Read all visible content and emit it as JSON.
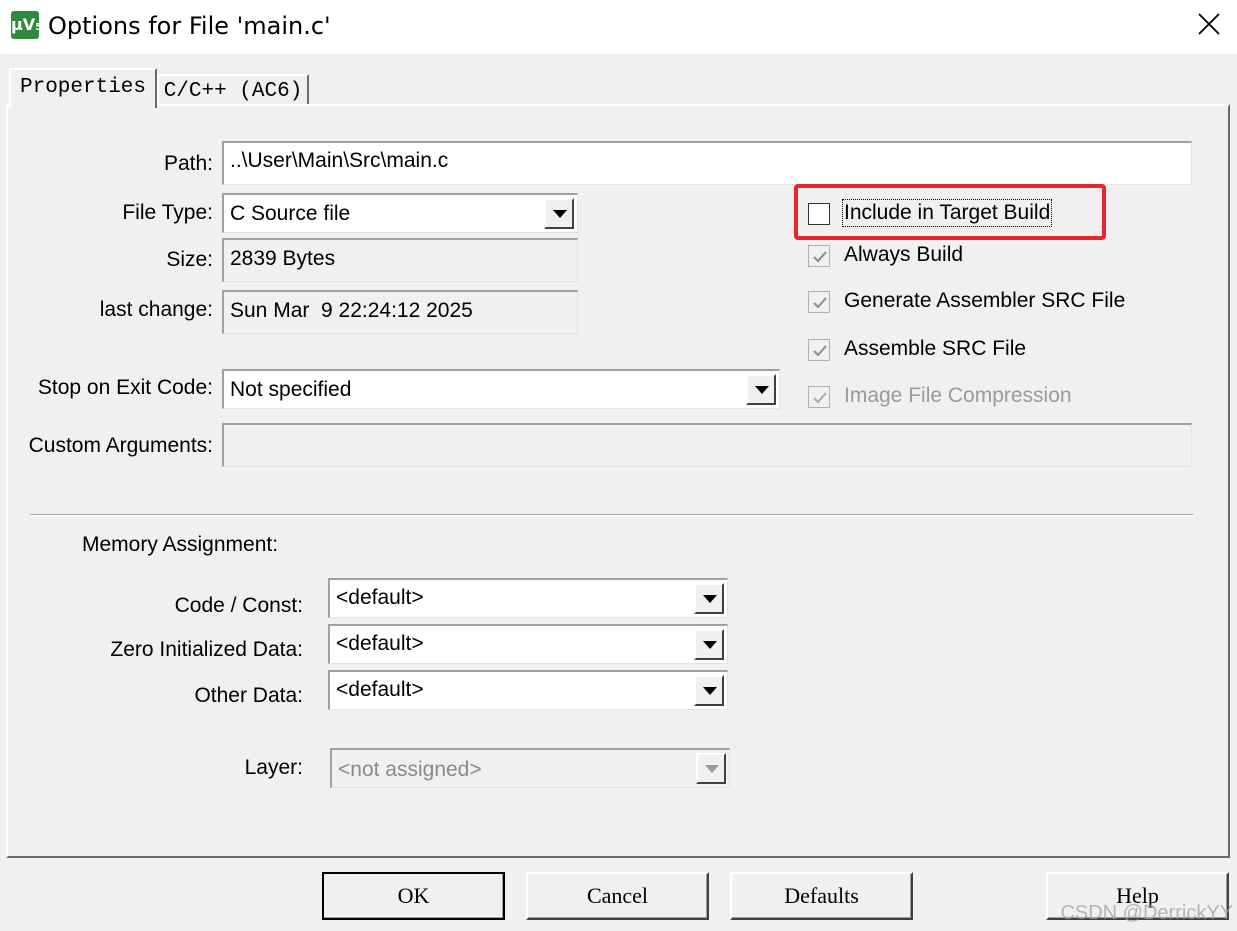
{
  "window": {
    "title": "Options for File 'main.c'",
    "icon_text": "μV",
    "icon_sub": "5"
  },
  "tabs": [
    {
      "label": "Properties",
      "active": true
    },
    {
      "label": "C/C++ (AC6)",
      "active": false
    }
  ],
  "properties": {
    "path_label": "Path:",
    "path_value": "..\\User\\Main\\Src\\main.c",
    "file_type_label": "File Type:",
    "file_type_value": "C Source file",
    "size_label": "Size:",
    "size_value": "2839 Bytes",
    "last_change_label": "last change:",
    "last_change_value": "Sun Mar  9 22:24:12 2025",
    "stop_exit_label": "Stop on Exit Code:",
    "stop_exit_value": "Not specified",
    "custom_args_label": "Custom Arguments:",
    "custom_args_value": ""
  },
  "checkboxes": {
    "include_target_build": {
      "label": "Include in Target Build",
      "checked": false,
      "enabled": true
    },
    "always_build": {
      "label": "Always Build",
      "checked": true,
      "enabled": true
    },
    "generate_asm_src": {
      "label": "Generate Assembler SRC File",
      "checked": true,
      "enabled": true
    },
    "assemble_src": {
      "label": "Assemble SRC File",
      "checked": true,
      "enabled": true
    },
    "image_compression": {
      "label": "Image File Compression",
      "checked": true,
      "enabled": false
    }
  },
  "memory": {
    "heading": "Memory Assignment:",
    "code_const_label": "Code / Const:",
    "code_const_value": "<default>",
    "zero_init_label": "Zero Initialized Data:",
    "zero_init_value": "<default>",
    "other_data_label": "Other Data:",
    "other_data_value": "<default>",
    "layer_label": "Layer:",
    "layer_value": "<not assigned>"
  },
  "buttons": {
    "ok": "OK",
    "cancel": "Cancel",
    "defaults": "Defaults",
    "help": "Help"
  },
  "watermark": "CSDN @DerrickYY",
  "colors": {
    "highlight": "#e8262c",
    "dialog_bg": "#f0f0f0",
    "icon_green": "#2f8a3e"
  }
}
